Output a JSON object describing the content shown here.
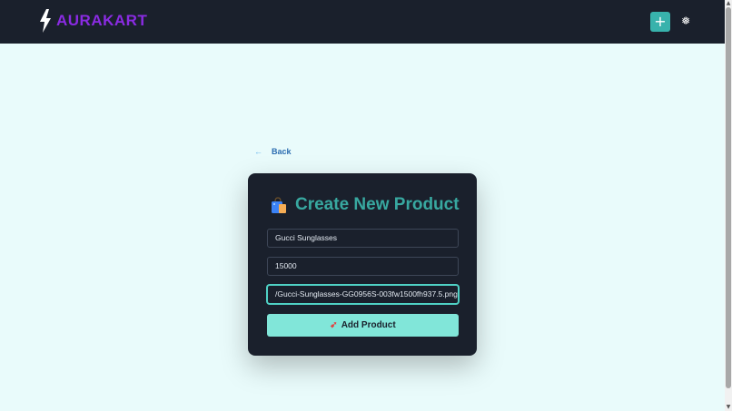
{
  "header": {
    "brand": "AURAKART",
    "add_icon": "plus-icon",
    "theme_icon": "sun-icon",
    "add_glyph": "+",
    "theme_glyph": "❅"
  },
  "nav": {
    "back_label": "Back",
    "back_glyph": "←"
  },
  "form": {
    "title": "Create New Product",
    "title_icon": "shopping-bag-icon",
    "name_value": "Gucci Sunglasses",
    "price_value": "15000",
    "image_value": "/Gucci-Sunglasses-GG0956S-003fw1500fh937.5.png",
    "submit_label": "Add Product",
    "submit_icon": "rocket-icon",
    "submit_glyph": "➹"
  },
  "colors": {
    "navbar": "#1a202c",
    "brand": "#8a2be2",
    "accent": "#38b2ac",
    "title": "#38a8a0",
    "button": "#81e6d9",
    "page_bg": "#e9fbfb"
  }
}
